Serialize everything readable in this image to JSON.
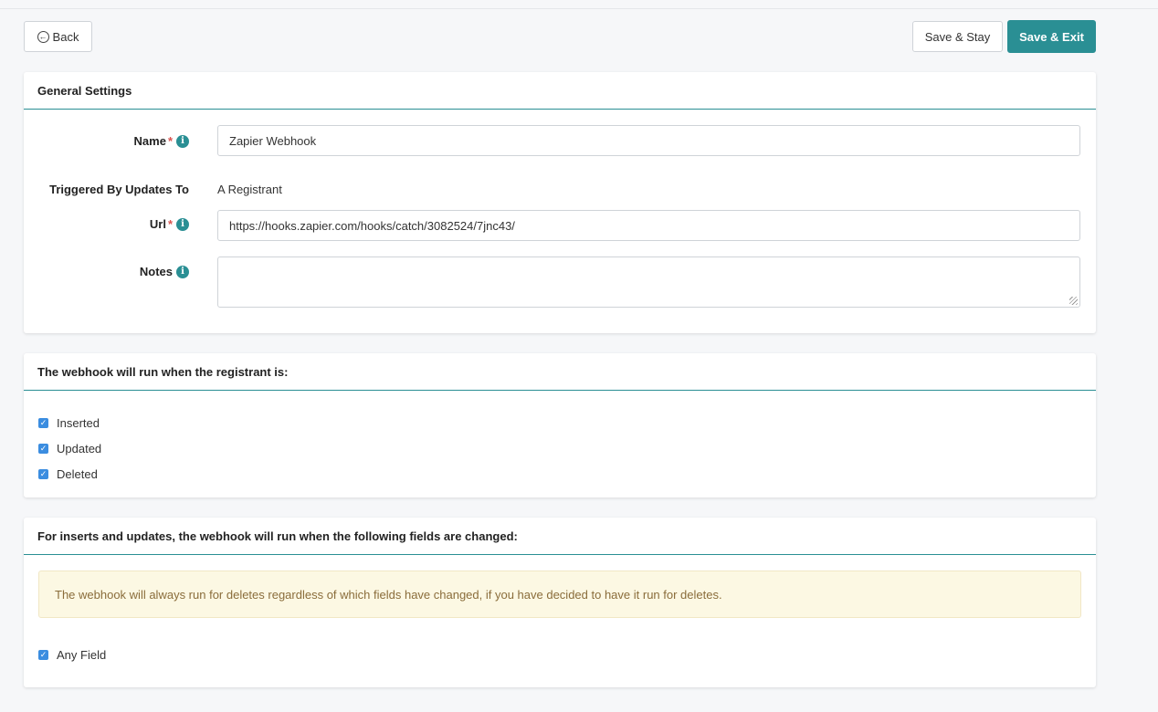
{
  "toolbar": {
    "back_label": "Back",
    "save_stay_label": "Save & Stay",
    "save_exit_label": "Save & Exit"
  },
  "general": {
    "title": "General Settings",
    "name_label": "Name",
    "name_value": "Zapier Webhook",
    "triggered_label": "Triggered By Updates To",
    "triggered_value": "A Registrant",
    "url_label": "Url",
    "url_value": "https://hooks.zapier.com/hooks/catch/3082524/7jnc43/",
    "notes_label": "Notes",
    "notes_value": "",
    "required_mark": "*",
    "info_glyph": "i"
  },
  "run_when": {
    "title": "The webhook will run when the registrant is:",
    "options": [
      {
        "label": "Inserted",
        "checked": true
      },
      {
        "label": "Updated",
        "checked": true
      },
      {
        "label": "Deleted",
        "checked": true
      }
    ]
  },
  "fields_changed": {
    "title": "For inserts and updates, the webhook will run when the following fields are changed:",
    "alert": "The webhook will always run for deletes regardless of which fields have changed, if you have decided to have it run for deletes.",
    "any_field_label": "Any Field",
    "any_field_checked": true
  },
  "colors": {
    "accent": "#2a8f94",
    "checkbox": "#3b8de0",
    "required": "#d9534f",
    "alert_bg": "#fcf8e3",
    "alert_text": "#8a6d3b"
  }
}
